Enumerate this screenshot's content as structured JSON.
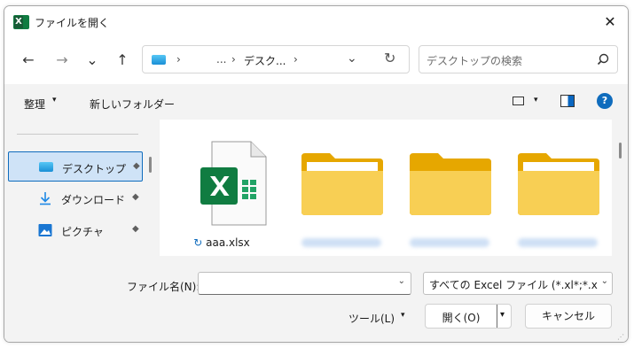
{
  "window": {
    "title": "ファイルを開く",
    "close": "✕"
  },
  "nav": {
    "back": "←",
    "forward": "→",
    "recent": "⌄",
    "up": "↑",
    "address": {
      "sep": "›",
      "ellipsis": "...",
      "crumb": "デスク...",
      "dropdown": "⌄",
      "refresh": "↻"
    },
    "search_placeholder": "デスクトップの検索"
  },
  "commands": {
    "arrange": "整理",
    "dd": "▾",
    "new_folder": "新しいフォルダー",
    "help": "?"
  },
  "sidebar": {
    "items": [
      {
        "label": "デスクトップ",
        "selected": true
      },
      {
        "label": "ダウンロード",
        "selected": false
      },
      {
        "label": "ピクチャ",
        "selected": false
      }
    ],
    "pin": "📌"
  },
  "content": {
    "files": [
      {
        "name": "aaa.xlsx",
        "type": "excel",
        "sync_icon": "↻"
      }
    ],
    "folders_blurred": 3
  },
  "footer": {
    "filename_label": "ファイル名(N):",
    "filename_value": "",
    "filter_value": "すべての Excel ファイル (*.xl*;*.xlsx;",
    "dd": "⌄",
    "tools_label": "ツール(L)",
    "tools_dd": "▾",
    "open_label": "開く(O)",
    "open_dd": "▾",
    "cancel_label": "キャンセル"
  },
  "colors": {
    "accent": "#0f6cbd",
    "excel_green": "#107c41",
    "folder_yellow": "#f4c846"
  }
}
